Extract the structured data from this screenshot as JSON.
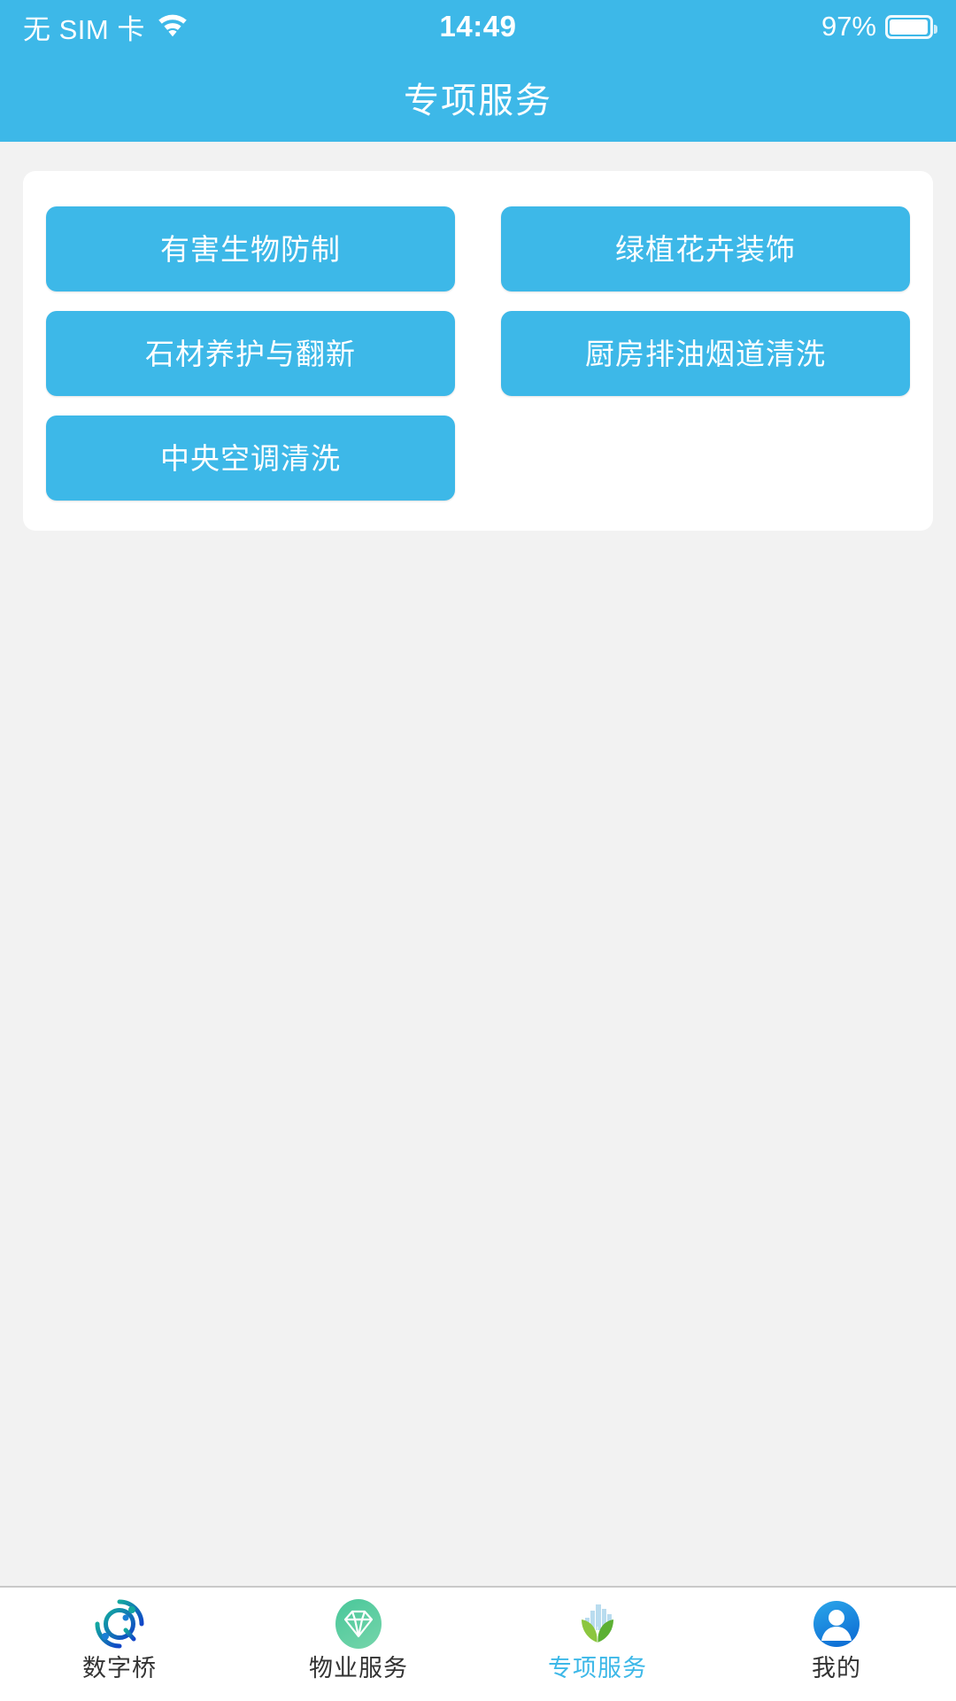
{
  "statusbar": {
    "carrier": "无 SIM 卡",
    "wifi_icon": "wifi-icon",
    "time": "14:49",
    "battery_text": "97%",
    "battery_level": 97,
    "battery_icon": "battery-icon"
  },
  "header": {
    "title": "专项服务",
    "background_color": "#3db8e8"
  },
  "main": {
    "services": [
      {
        "label": "有害生物防制"
      },
      {
        "label": "绿植花卉装饰"
      },
      {
        "label": "石材养护与翻新"
      },
      {
        "label": "厨房排油烟道清洗"
      },
      {
        "label": "中央空调清洗"
      }
    ],
    "button_color": "#3db8e8",
    "card_color": "#ffffff"
  },
  "tabbar": {
    "active_color": "#3db8e8",
    "inactive_color": "#333333",
    "items": [
      {
        "label": "数字桥",
        "icon": "digital-bridge-icon",
        "active": false
      },
      {
        "label": "物业服务",
        "icon": "diamond-icon",
        "active": false
      },
      {
        "label": "专项服务",
        "icon": "city-leaf-icon",
        "active": true
      },
      {
        "label": "我的",
        "icon": "user-avatar-icon",
        "active": false
      }
    ]
  }
}
